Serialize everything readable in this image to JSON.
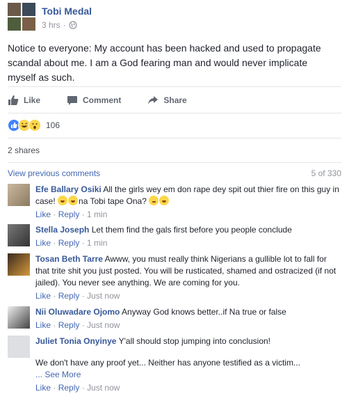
{
  "post": {
    "author": "Tobi Medal",
    "time": "3 hrs",
    "separator": "·",
    "text": "Notice to everyone: My account has been hacked and used to propagate scandal about me. I am a God fearing man and would never implicate myself as such."
  },
  "actions": {
    "like": "Like",
    "comment": "Comment",
    "share": "Share"
  },
  "reactions": {
    "count": "106",
    "types": [
      "like-icon",
      "haha-icon",
      "wow-icon"
    ]
  },
  "shares": "2 shares",
  "comments_header": {
    "view_previous": "View previous comments",
    "pager": "5 of 330"
  },
  "comment_actions": {
    "like": "Like",
    "reply": "Reply",
    "sep": " · "
  },
  "comments": [
    {
      "author": "Efe Ballary Osiki",
      "text": "All the girls wey em don rape dey spit out thier fire on this guy in case!",
      "text2": "na Tobi tape Ona?",
      "time": "1 min"
    },
    {
      "author": "Stella Joseph",
      "text": "Let them find the gals first before you people conclude",
      "time": "1 min"
    },
    {
      "author": "Tosan Beth Tarre",
      "text": "Awww, you must really think Nigerians a gullible lot to fall for that trite shit you just posted. You will be rusticated, shamed and ostracized (if not jailed). You never see anything. We are coming for you.",
      "time": "Just now"
    },
    {
      "author": "Nii Oluwadare Ojomo",
      "text": "Anyway God knows better..if Na true or false",
      "time": "Just now"
    },
    {
      "author": "Juliet Tonia Onyinye",
      "text": "Y'all should stop jumping into conclusion!",
      "text2": "We don't have any proof yet... Neither has anyone testified as a victim...",
      "see_more": "... See More",
      "time": "Just now"
    }
  ],
  "colors": {
    "link": "#365899",
    "blue_action": "#4267b2",
    "muted": "#90949c",
    "text": "#1d2129"
  }
}
